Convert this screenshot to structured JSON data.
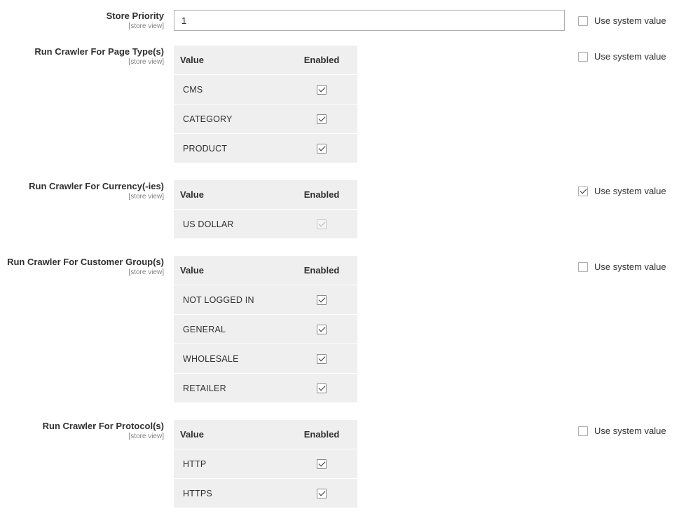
{
  "store_priority": {
    "label": "Store Priority",
    "scope": "[store view]",
    "value": "1",
    "use_system_value": {
      "label": "Use system value",
      "checked": false
    }
  },
  "grid_headers": {
    "value": "Value",
    "enabled": "Enabled"
  },
  "page_types": {
    "label": "Run Crawler For Page Type(s)",
    "scope": "[store view]",
    "rows": [
      {
        "value": "CMS",
        "enabled": true
      },
      {
        "value": "CATEGORY",
        "enabled": true
      },
      {
        "value": "PRODUCT",
        "enabled": true
      }
    ],
    "use_system_value": {
      "label": "Use system value",
      "checked": false
    }
  },
  "currencies": {
    "label": "Run Crawler For Currency(-ies)",
    "scope": "[store view]",
    "rows": [
      {
        "value": "US DOLLAR",
        "enabled": true,
        "disabled": true
      }
    ],
    "use_system_value": {
      "label": "Use system value",
      "checked": true
    }
  },
  "customer_groups": {
    "label": "Run Crawler For Customer Group(s)",
    "scope": "[store view]",
    "rows": [
      {
        "value": "NOT LOGGED IN",
        "enabled": true
      },
      {
        "value": "GENERAL",
        "enabled": true
      },
      {
        "value": "WHOLESALE",
        "enabled": true
      },
      {
        "value": "RETAILER",
        "enabled": true
      }
    ],
    "use_system_value": {
      "label": "Use system value",
      "checked": false
    }
  },
  "protocols": {
    "label": "Run Crawler For Protocol(s)",
    "scope": "[store view]",
    "rows": [
      {
        "value": "HTTP",
        "enabled": true
      },
      {
        "value": "HTTPS",
        "enabled": true
      }
    ],
    "use_system_value": {
      "label": "Use system value",
      "checked": false
    }
  }
}
